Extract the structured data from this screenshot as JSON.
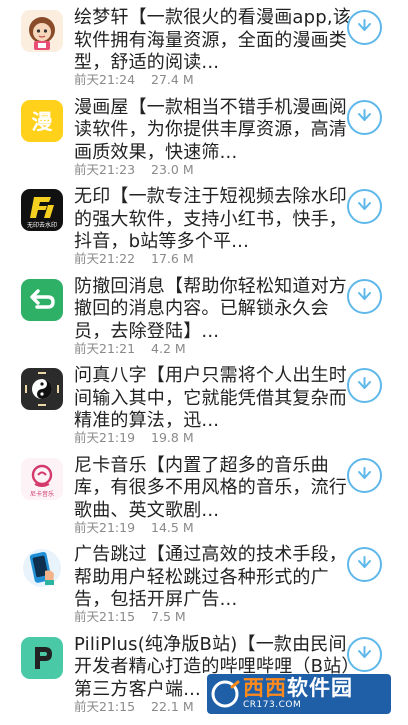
{
  "apps": [
    {
      "name": "绘梦轩",
      "title": "绘梦轩【一款很火的看漫画app,该软件拥有海量资源，全面的漫画类型，舒适的阅读...",
      "date": "前天21:24",
      "size": "27.4 M",
      "icon": "cartoon-girl-avatar-icon",
      "accent": "#f3d9b8"
    },
    {
      "name": "漫画屋",
      "title": "漫画屋【一款相当不错手机漫画阅读软件，为你提供丰厚资源，高清画质效果，快速筛...",
      "date": "前天21:23",
      "size": "23.0 M",
      "icon": "manhuawu-logo-icon",
      "accent": "#ffd11a"
    },
    {
      "name": "无印",
      "title": "无印【一款专注于短视频去除水印的强大软件，支持小红书，快手，抖音，b站等多个平...",
      "date": "前天21:22",
      "size": "17.6 M",
      "icon": "wuyin-logo-icon",
      "accent": "#111111",
      "icon_text": "无印去水印"
    },
    {
      "name": "防撤回消息",
      "title": "防撤回消息【帮助你轻松知道对方撤回的消息内容。已解锁永久会员，去除登陆】...",
      "date": "前天21:21",
      "size": "4.2 M",
      "icon": "undo-arrow-icon",
      "accent": "#2fb067"
    },
    {
      "name": "问真八字",
      "title": "问真八字【用户只需将个人出生时间输入其中，它就能凭借其复杂而精准的算法，迅...",
      "date": "前天21:19",
      "size": "19.8 M",
      "icon": "yin-yang-bagua-icon",
      "accent": "#2b2b2b"
    },
    {
      "name": "尼卡音乐",
      "title": "尼卡音乐【内置了超多的音乐曲库，有很多不用风格的音乐，流行歌曲、英文歌剧...",
      "date": "前天21:19",
      "size": "14.5 M",
      "icon": "nika-music-icon",
      "accent": "#d4396b",
      "icon_text": "尼卡音乐"
    },
    {
      "name": "广告跳过",
      "title": "广告跳过【通过高效的技术手段，帮助用户轻松跳过各种形式的广告，包括开屏广告...",
      "date": "前天21:15",
      "size": "7.5 M",
      "icon": "phone-tap-icon",
      "accent": "#1f8fd6"
    },
    {
      "name": "PiliPlus",
      "title": "PiliPlus(纯净版B站)【一款由民间开发者精心打造的哔哩哔哩（B站）第三方客户端...",
      "date": "前天21:15",
      "size": "22.1 M",
      "icon": "piliplus-p-icon",
      "accent": "#49c9a6"
    }
  ],
  "download_icon": "download-arrow-icon",
  "download_color": "#5fb8ea",
  "watermark": {
    "main_a": "西西",
    "main_b": "软件园",
    "sub": "CR173.COM"
  }
}
